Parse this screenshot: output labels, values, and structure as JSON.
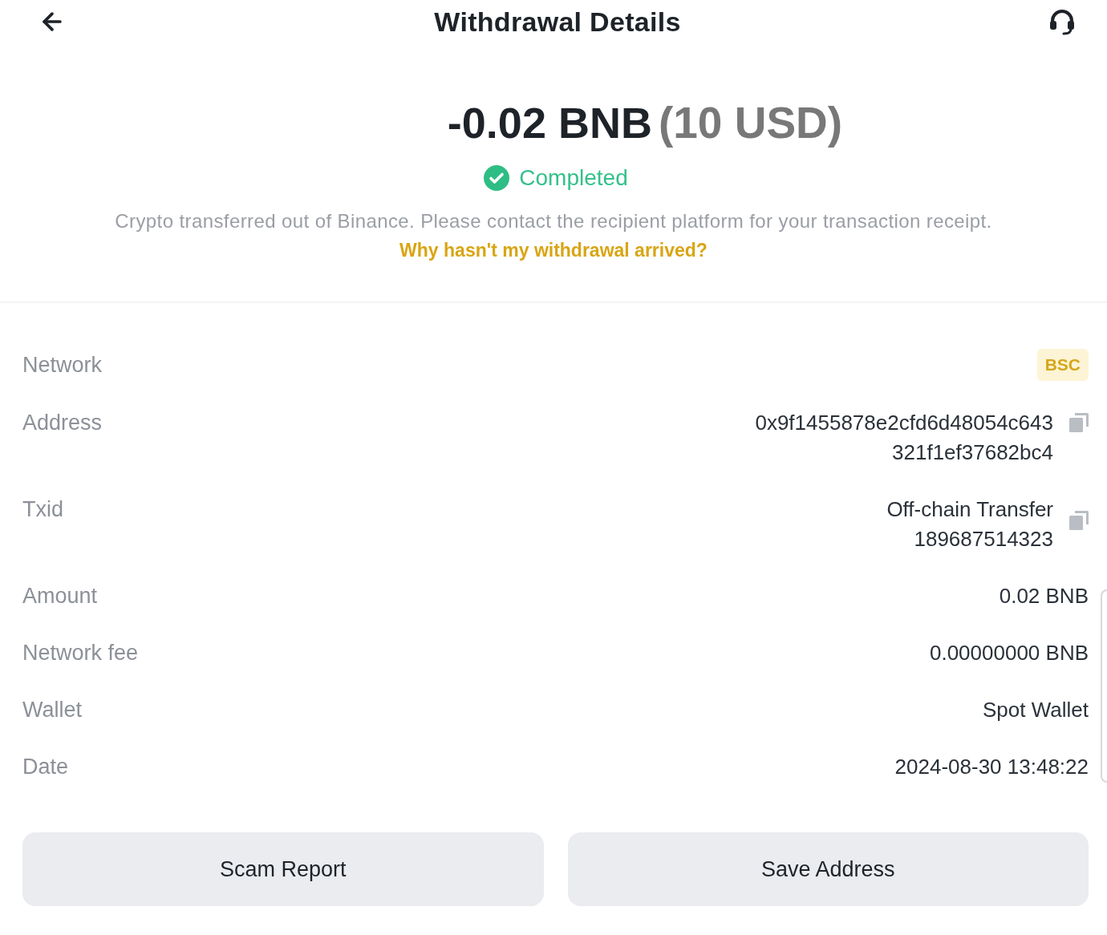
{
  "header": {
    "title": "Withdrawal Details"
  },
  "summary": {
    "amount": "-0.02 BNB",
    "fiat": "(10 USD)",
    "status": {
      "kind": "completed",
      "label": "Completed"
    },
    "note": "Crypto transferred out of Binance. Please contact the recipient platform for your transaction receipt.",
    "help_link": "Why hasn't my withdrawal arrived?"
  },
  "details": [
    {
      "label": "Network",
      "kind": "tag",
      "value": "BSC"
    },
    {
      "label": "Address",
      "kind": "copyable",
      "lines": [
        "0x9f1455878e2cfd6d48054c643",
        "321f1ef37682bc4"
      ]
    },
    {
      "label": "Txid",
      "kind": "copyable",
      "lines": [
        "Off-chain Transfer",
        "189687514323"
      ]
    },
    {
      "label": "Amount",
      "kind": "text",
      "value": "0.02 BNB"
    },
    {
      "label": "Network fee",
      "kind": "text",
      "value": "0.00000000 BNB"
    },
    {
      "label": "Wallet",
      "kind": "text",
      "value": "Spot Wallet"
    },
    {
      "label": "Date",
      "kind": "text",
      "value": "2024-08-30 13:48:22"
    }
  ],
  "buttons": [
    "Scam Report",
    "Save Address"
  ]
}
